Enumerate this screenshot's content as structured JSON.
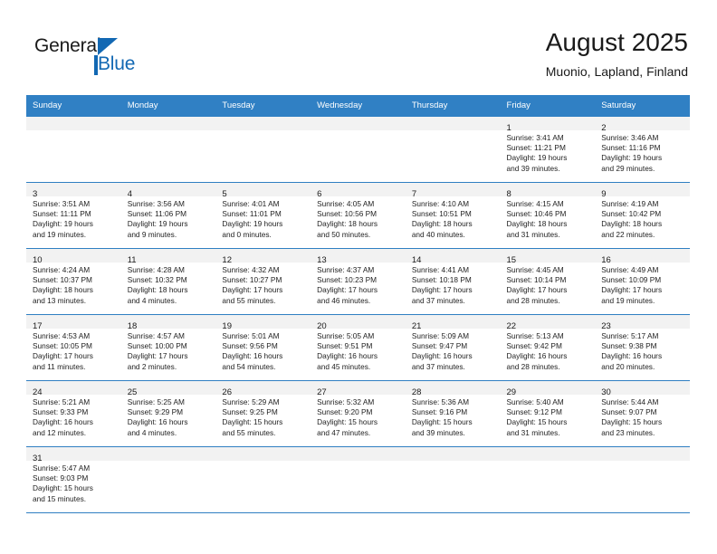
{
  "brand": {
    "name_part1": "General",
    "name_part2": "Blue",
    "colors": {
      "blue": "#1268b3",
      "header_blue": "#3080c4",
      "band_gray": "#f2f2f2"
    }
  },
  "header": {
    "title": "August 2025",
    "subtitle": "Muonio, Lapland, Finland"
  },
  "calendar": {
    "weekday_headers": [
      "Sunday",
      "Monday",
      "Tuesday",
      "Wednesday",
      "Thursday",
      "Friday",
      "Saturday"
    ],
    "weeks": [
      [
        {
          "day": "",
          "lines": []
        },
        {
          "day": "",
          "lines": []
        },
        {
          "day": "",
          "lines": []
        },
        {
          "day": "",
          "lines": []
        },
        {
          "day": "",
          "lines": []
        },
        {
          "day": "1",
          "lines": [
            "Sunrise: 3:41 AM",
            "Sunset: 11:21 PM",
            "Daylight: 19 hours",
            "and 39 minutes."
          ]
        },
        {
          "day": "2",
          "lines": [
            "Sunrise: 3:46 AM",
            "Sunset: 11:16 PM",
            "Daylight: 19 hours",
            "and 29 minutes."
          ]
        }
      ],
      [
        {
          "day": "3",
          "lines": [
            "Sunrise: 3:51 AM",
            "Sunset: 11:11 PM",
            "Daylight: 19 hours",
            "and 19 minutes."
          ]
        },
        {
          "day": "4",
          "lines": [
            "Sunrise: 3:56 AM",
            "Sunset: 11:06 PM",
            "Daylight: 19 hours",
            "and 9 minutes."
          ]
        },
        {
          "day": "5",
          "lines": [
            "Sunrise: 4:01 AM",
            "Sunset: 11:01 PM",
            "Daylight: 19 hours",
            "and 0 minutes."
          ]
        },
        {
          "day": "6",
          "lines": [
            "Sunrise: 4:05 AM",
            "Sunset: 10:56 PM",
            "Daylight: 18 hours",
            "and 50 minutes."
          ]
        },
        {
          "day": "7",
          "lines": [
            "Sunrise: 4:10 AM",
            "Sunset: 10:51 PM",
            "Daylight: 18 hours",
            "and 40 minutes."
          ]
        },
        {
          "day": "8",
          "lines": [
            "Sunrise: 4:15 AM",
            "Sunset: 10:46 PM",
            "Daylight: 18 hours",
            "and 31 minutes."
          ]
        },
        {
          "day": "9",
          "lines": [
            "Sunrise: 4:19 AM",
            "Sunset: 10:42 PM",
            "Daylight: 18 hours",
            "and 22 minutes."
          ]
        }
      ],
      [
        {
          "day": "10",
          "lines": [
            "Sunrise: 4:24 AM",
            "Sunset: 10:37 PM",
            "Daylight: 18 hours",
            "and 13 minutes."
          ]
        },
        {
          "day": "11",
          "lines": [
            "Sunrise: 4:28 AM",
            "Sunset: 10:32 PM",
            "Daylight: 18 hours",
            "and 4 minutes."
          ]
        },
        {
          "day": "12",
          "lines": [
            "Sunrise: 4:32 AM",
            "Sunset: 10:27 PM",
            "Daylight: 17 hours",
            "and 55 minutes."
          ]
        },
        {
          "day": "13",
          "lines": [
            "Sunrise: 4:37 AM",
            "Sunset: 10:23 PM",
            "Daylight: 17 hours",
            "and 46 minutes."
          ]
        },
        {
          "day": "14",
          "lines": [
            "Sunrise: 4:41 AM",
            "Sunset: 10:18 PM",
            "Daylight: 17 hours",
            "and 37 minutes."
          ]
        },
        {
          "day": "15",
          "lines": [
            "Sunrise: 4:45 AM",
            "Sunset: 10:14 PM",
            "Daylight: 17 hours",
            "and 28 minutes."
          ]
        },
        {
          "day": "16",
          "lines": [
            "Sunrise: 4:49 AM",
            "Sunset: 10:09 PM",
            "Daylight: 17 hours",
            "and 19 minutes."
          ]
        }
      ],
      [
        {
          "day": "17",
          "lines": [
            "Sunrise: 4:53 AM",
            "Sunset: 10:05 PM",
            "Daylight: 17 hours",
            "and 11 minutes."
          ]
        },
        {
          "day": "18",
          "lines": [
            "Sunrise: 4:57 AM",
            "Sunset: 10:00 PM",
            "Daylight: 17 hours",
            "and 2 minutes."
          ]
        },
        {
          "day": "19",
          "lines": [
            "Sunrise: 5:01 AM",
            "Sunset: 9:56 PM",
            "Daylight: 16 hours",
            "and 54 minutes."
          ]
        },
        {
          "day": "20",
          "lines": [
            "Sunrise: 5:05 AM",
            "Sunset: 9:51 PM",
            "Daylight: 16 hours",
            "and 45 minutes."
          ]
        },
        {
          "day": "21",
          "lines": [
            "Sunrise: 5:09 AM",
            "Sunset: 9:47 PM",
            "Daylight: 16 hours",
            "and 37 minutes."
          ]
        },
        {
          "day": "22",
          "lines": [
            "Sunrise: 5:13 AM",
            "Sunset: 9:42 PM",
            "Daylight: 16 hours",
            "and 28 minutes."
          ]
        },
        {
          "day": "23",
          "lines": [
            "Sunrise: 5:17 AM",
            "Sunset: 9:38 PM",
            "Daylight: 16 hours",
            "and 20 minutes."
          ]
        }
      ],
      [
        {
          "day": "24",
          "lines": [
            "Sunrise: 5:21 AM",
            "Sunset: 9:33 PM",
            "Daylight: 16 hours",
            "and 12 minutes."
          ]
        },
        {
          "day": "25",
          "lines": [
            "Sunrise: 5:25 AM",
            "Sunset: 9:29 PM",
            "Daylight: 16 hours",
            "and 4 minutes."
          ]
        },
        {
          "day": "26",
          "lines": [
            "Sunrise: 5:29 AM",
            "Sunset: 9:25 PM",
            "Daylight: 15 hours",
            "and 55 minutes."
          ]
        },
        {
          "day": "27",
          "lines": [
            "Sunrise: 5:32 AM",
            "Sunset: 9:20 PM",
            "Daylight: 15 hours",
            "and 47 minutes."
          ]
        },
        {
          "day": "28",
          "lines": [
            "Sunrise: 5:36 AM",
            "Sunset: 9:16 PM",
            "Daylight: 15 hours",
            "and 39 minutes."
          ]
        },
        {
          "day": "29",
          "lines": [
            "Sunrise: 5:40 AM",
            "Sunset: 9:12 PM",
            "Daylight: 15 hours",
            "and 31 minutes."
          ]
        },
        {
          "day": "30",
          "lines": [
            "Sunrise: 5:44 AM",
            "Sunset: 9:07 PM",
            "Daylight: 15 hours",
            "and 23 minutes."
          ]
        }
      ],
      [
        {
          "day": "31",
          "lines": [
            "Sunrise: 5:47 AM",
            "Sunset: 9:03 PM",
            "Daylight: 15 hours",
            "and 15 minutes."
          ]
        },
        {
          "day": "",
          "lines": []
        },
        {
          "day": "",
          "lines": []
        },
        {
          "day": "",
          "lines": []
        },
        {
          "day": "",
          "lines": []
        },
        {
          "day": "",
          "lines": []
        },
        {
          "day": "",
          "lines": []
        }
      ]
    ]
  }
}
